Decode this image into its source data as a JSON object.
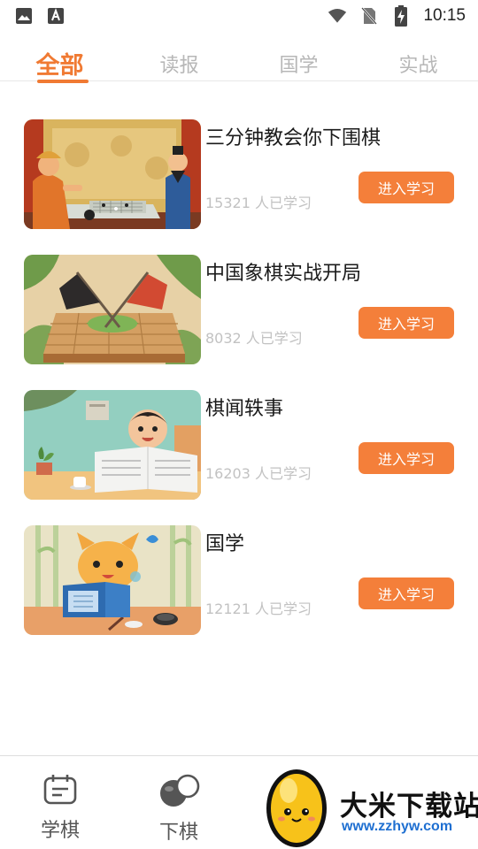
{
  "status_bar": {
    "time": "10:15",
    "left_icons": [
      "image-icon",
      "a-keyboard-icon"
    ],
    "right_icons": [
      "wifi-icon",
      "no-sim-icon",
      "battery-charging-icon"
    ]
  },
  "tabs": [
    {
      "label": "全部",
      "active": true
    },
    {
      "label": "读报",
      "active": false
    },
    {
      "label": "国学",
      "active": false
    },
    {
      "label": "实战",
      "active": false
    }
  ],
  "courses": [
    {
      "title": "三分钟教会你下围棋",
      "count": "15321 人已学习",
      "button": "进入学习",
      "thumb": "go-players-illustration"
    },
    {
      "title": "中国象棋实战开局",
      "count": "8032 人已学习",
      "button": "进入学习",
      "thumb": "chess-flags-illustration"
    },
    {
      "title": "棋闻轶事",
      "count": "16203 人已学习",
      "button": "进入学习",
      "thumb": "boy-reading-newspaper-illustration"
    },
    {
      "title": "国学",
      "count": "12121 人已学习",
      "button": "进入学习",
      "thumb": "cat-reading-book-illustration"
    }
  ],
  "bottom_nav": [
    {
      "label": "学棋",
      "icon": "calendar-book-icon"
    },
    {
      "label": "下棋",
      "icon": "go-stones-icon"
    }
  ],
  "watermark": {
    "title": "大米下载站",
    "url": "www.zzhyw.com"
  },
  "colors": {
    "accent": "#f07a33",
    "button": "#f47f3a",
    "muted_text": "#c2c2c2",
    "watermark_url": "#1e6fd1"
  }
}
